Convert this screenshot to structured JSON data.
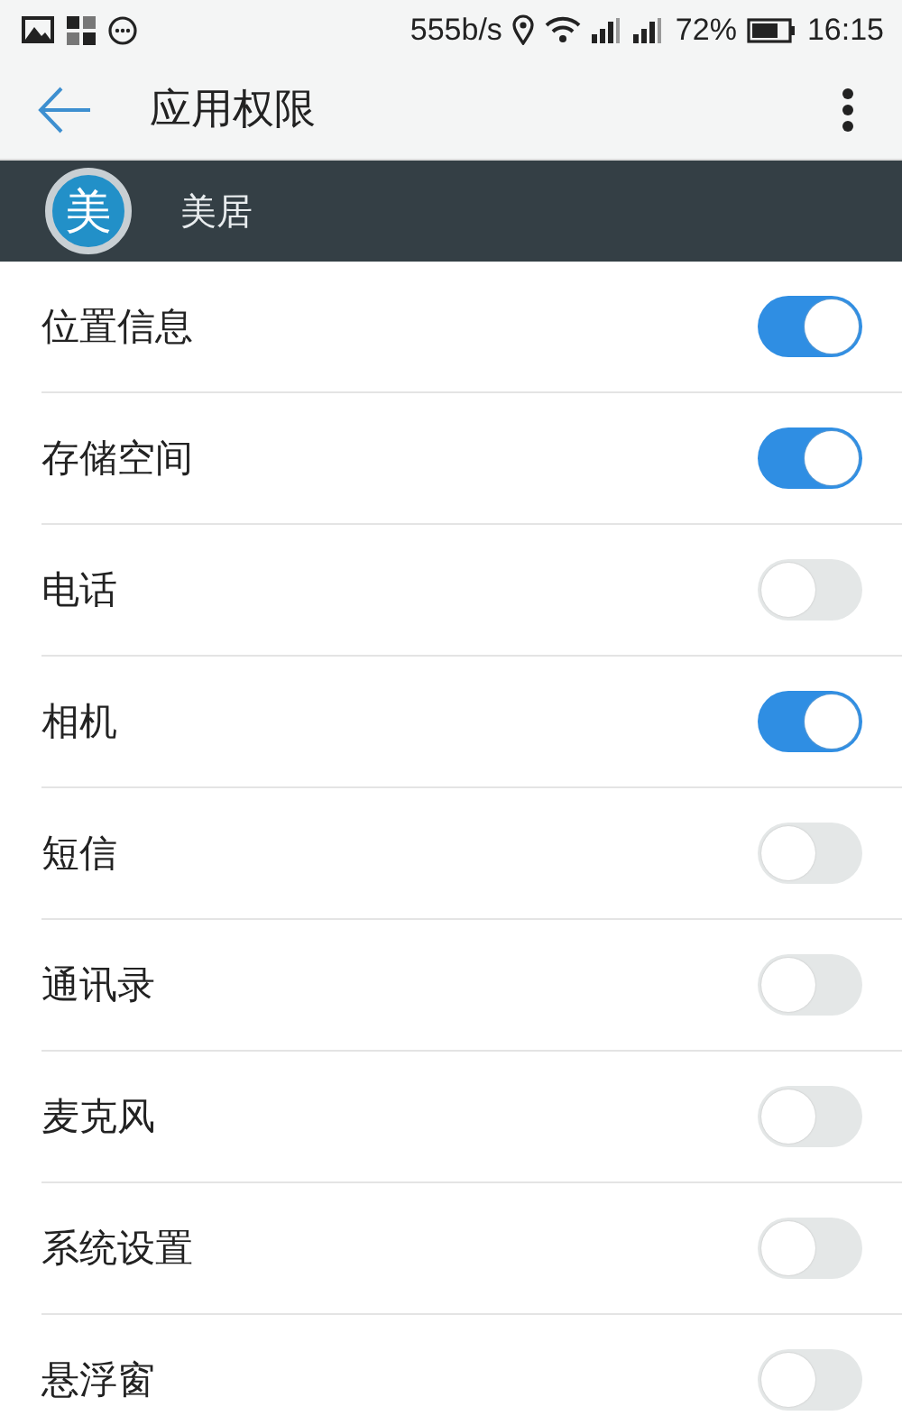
{
  "status_bar": {
    "speed": "555b/s",
    "battery": "72%",
    "time": "16:15"
  },
  "header": {
    "title": "应用权限"
  },
  "app": {
    "logo": "美",
    "name": "美居"
  },
  "permissions": [
    {
      "label": "位置信息",
      "on": true
    },
    {
      "label": "存储空间",
      "on": true
    },
    {
      "label": "电话",
      "on": false
    },
    {
      "label": "相机",
      "on": true
    },
    {
      "label": "短信",
      "on": false
    },
    {
      "label": "通讯录",
      "on": false
    },
    {
      "label": "麦克风",
      "on": false
    },
    {
      "label": "系统设置",
      "on": false
    },
    {
      "label": "悬浮窗",
      "on": false
    }
  ]
}
